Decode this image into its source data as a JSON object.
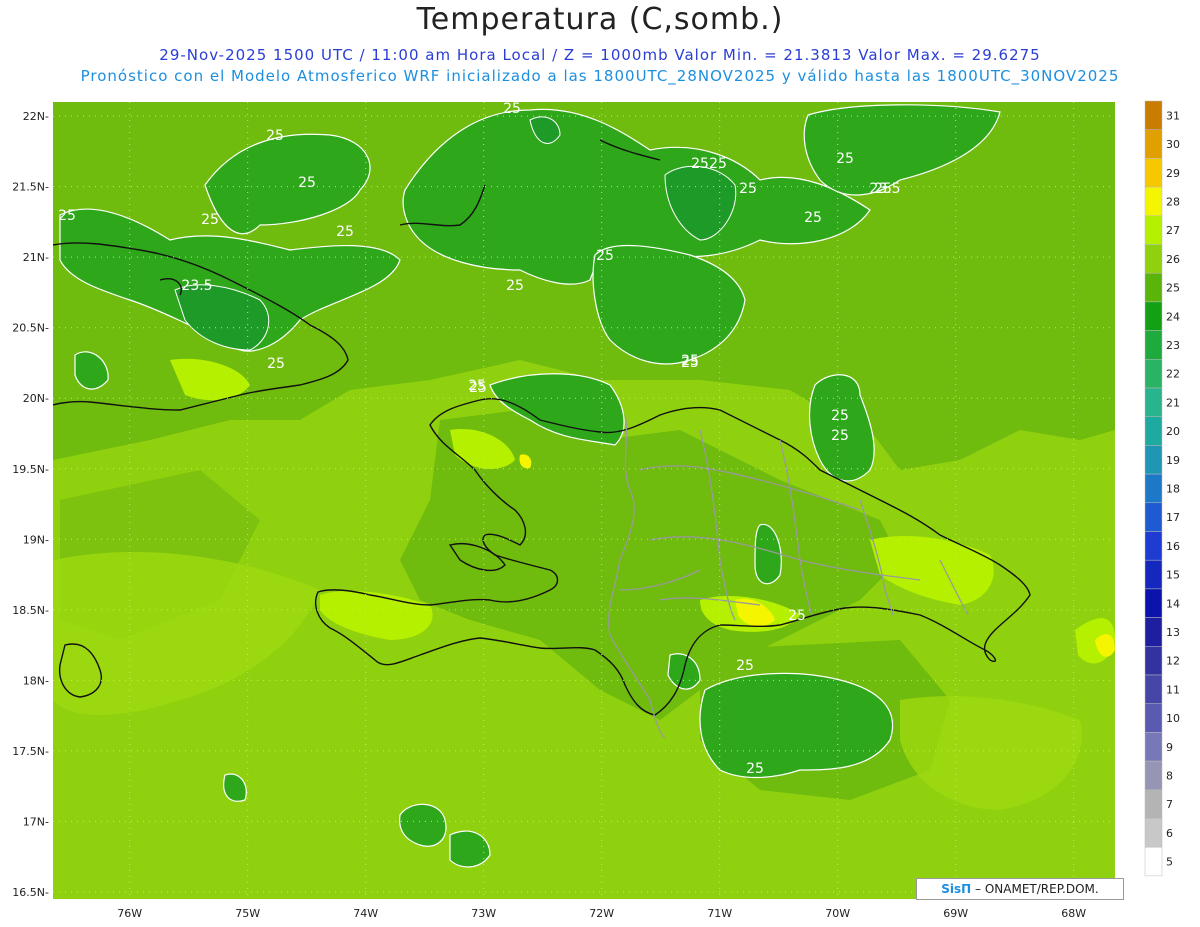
{
  "header": {
    "title": "Temperatura (C,somb.)",
    "line1": "29-Nov-2025 1500 UTC / 11:00 am Hora Local / Z = 1000mb  Valor Min. = 21.3813  Valor Max. = 29.6275",
    "line2": "Pronóstico con el Modelo Atmosferico WRF inicializado a las 1800UTC_28NOV2025 y válido hasta las  1800UTC_30NOV2025"
  },
  "map": {
    "lon_range": [
      -76.65,
      -67.65
    ],
    "lat_range": [
      16.45,
      22.1
    ],
    "lat_ticks": [
      "22N",
      "21.5N",
      "21N",
      "20.5N",
      "20N",
      "19.5N",
      "19N",
      "18.5N",
      "18N",
      "17.5N",
      "17N",
      "16.5N"
    ],
    "lon_ticks": [
      "76W",
      "75W",
      "74W",
      "73W",
      "72W",
      "71W",
      "70W",
      "69W",
      "68W"
    ],
    "background_color": "#8fd10f",
    "contour_labels": [
      "25",
      "25",
      "25",
      "25",
      "25",
      "23.5",
      "25",
      "25",
      "25",
      "25",
      "25",
      "23.5",
      "25",
      "25",
      "25",
      "25",
      "25",
      "25",
      "25",
      "25",
      "25",
      "25",
      "25",
      "25",
      "25",
      "25"
    ],
    "value_min": 21.3813,
    "value_max": 29.6275
  },
  "colorbar": {
    "levels": [
      "31",
      "30",
      "29",
      "28",
      "27",
      "26",
      "25",
      "24",
      "23",
      "22",
      "21",
      "20",
      "19",
      "18",
      "17",
      "16",
      "15",
      "14",
      "13",
      "12",
      "11",
      "10",
      "9",
      "8",
      "7",
      "6",
      "5"
    ],
    "colors": [
      "#c87d00",
      "#e0a000",
      "#f5c800",
      "#f5f500",
      "#b4f000",
      "#8fd10f",
      "#5ab40a",
      "#14a014",
      "#1eaa3c",
      "#28b464",
      "#28b48c",
      "#1eaaa0",
      "#1e96b4",
      "#1e78c8",
      "#1e5ad2",
      "#1e3cd2",
      "#1428be",
      "#0a14aa",
      "#1e1ea0",
      "#3232a0",
      "#4646a8",
      "#5a5ab0",
      "#7878b8",
      "#9696b4",
      "#b4b4b4",
      "#c8c8c8",
      "#ffffff"
    ]
  },
  "credit": {
    "brand": "SisΠ",
    "text": " – ONAMET/REP.DOM."
  }
}
